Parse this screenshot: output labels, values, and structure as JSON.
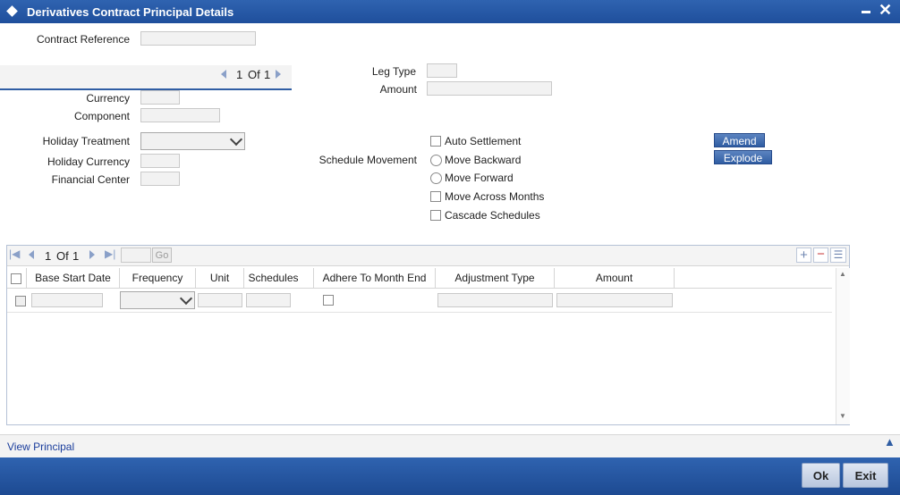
{
  "window": {
    "title": "Derivatives Contract Principal Details"
  },
  "header": {
    "contract_reference_label": "Contract Reference",
    "contract_reference_value": ""
  },
  "leg_nav": {
    "page": "1",
    "of_label": "Of",
    "total": "1"
  },
  "left_fields": {
    "currency_label": "Currency",
    "component_label": "Component",
    "holiday_treatment_label": "Holiday Treatment",
    "holiday_currency_label": "Holiday Currency",
    "financial_center_label": "Financial Center"
  },
  "right_fields": {
    "leg_type_label": "Leg Type",
    "amount_label": "Amount"
  },
  "schedule": {
    "schedule_movement_label": "Schedule Movement",
    "auto_settlement": "Auto Settlement",
    "move_backward": "Move Backward",
    "move_forward": "Move Forward",
    "move_across_months": "Move Across Months",
    "cascade_schedules": "Cascade Schedules"
  },
  "actions": {
    "amend": "Amend",
    "explode": "Explode"
  },
  "grid_nav": {
    "page": "1",
    "of_label": "Of",
    "total": "1",
    "go": "Go"
  },
  "grid": {
    "columns": [
      "Base Start Date",
      "Frequency",
      "Unit",
      "Schedules",
      "Adhere To Month End",
      "Adjustment Type",
      "Amount"
    ]
  },
  "footer": {
    "view_principal": "View Principal",
    "ok": "Ok",
    "exit": "Exit"
  },
  "colors": {
    "titlebar": "#2f63b0",
    "link": "#1a3d9c"
  }
}
